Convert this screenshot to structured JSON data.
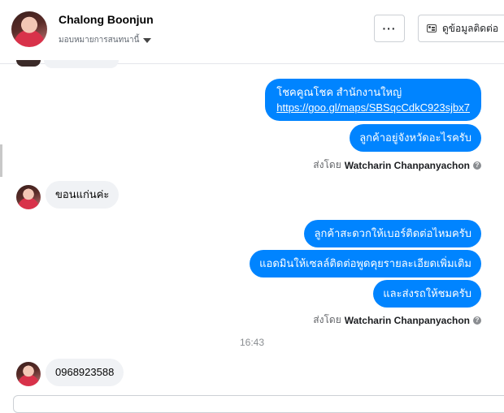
{
  "header": {
    "contact_name": "Chalong Boonjun",
    "assign_label": "มอบหมายการสนทนานี้",
    "more_label": "···",
    "view_contact_label": "ดูข้อมูลติดต่อ"
  },
  "messages": [
    {
      "dir": "out",
      "line1": "โชคคูณโชค สำนักงานใหญ่",
      "link": "https://goo.gl/maps/SBSqcCdkC923sjbx7"
    },
    {
      "dir": "out",
      "text": "ลูกค้าอยู่จังหวัดอะไรครับ"
    },
    {
      "dir": "in",
      "text": "ขอนแก่นค่ะ"
    },
    {
      "dir": "out",
      "text": "ลูกค้าสะดวกให้เบอร์ติดต่อไหมครับ"
    },
    {
      "dir": "out",
      "text": "แอดมินให้เซลล์ติดต่อพูดคุยรายละเอียดเพิ่มเติม"
    },
    {
      "dir": "out",
      "text": "และส่งรถให้ชมครับ"
    },
    {
      "dir": "in",
      "text": "0968923588"
    }
  ],
  "sent_by": {
    "prefix": "ส่งโดย",
    "agent_name": "Watcharin Chanpanyachon",
    "info_icon": "?"
  },
  "timestamp": "16:43",
  "colors": {
    "outgoing": "#0084ff",
    "incoming": "#f0f2f5"
  }
}
